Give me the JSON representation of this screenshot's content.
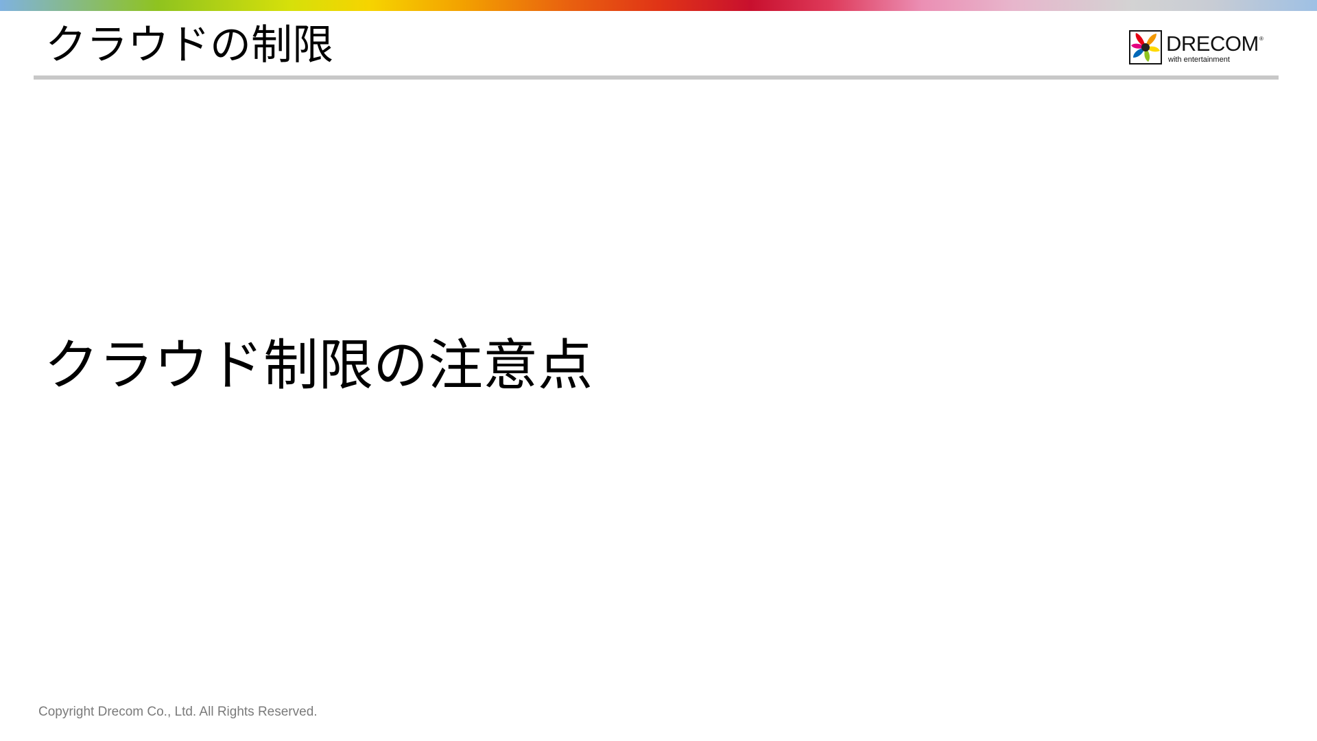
{
  "header": {
    "title": "クラウドの制限"
  },
  "logo": {
    "icon": "drecom-flower-icon",
    "name": "DRECOM",
    "trademark": "®",
    "tagline": "with entertainment"
  },
  "slide": {
    "section_title": "クラウド制限の注意点"
  },
  "footer": {
    "copyright": "Copyright Drecom Co., Ltd. All Rights Reserved."
  }
}
